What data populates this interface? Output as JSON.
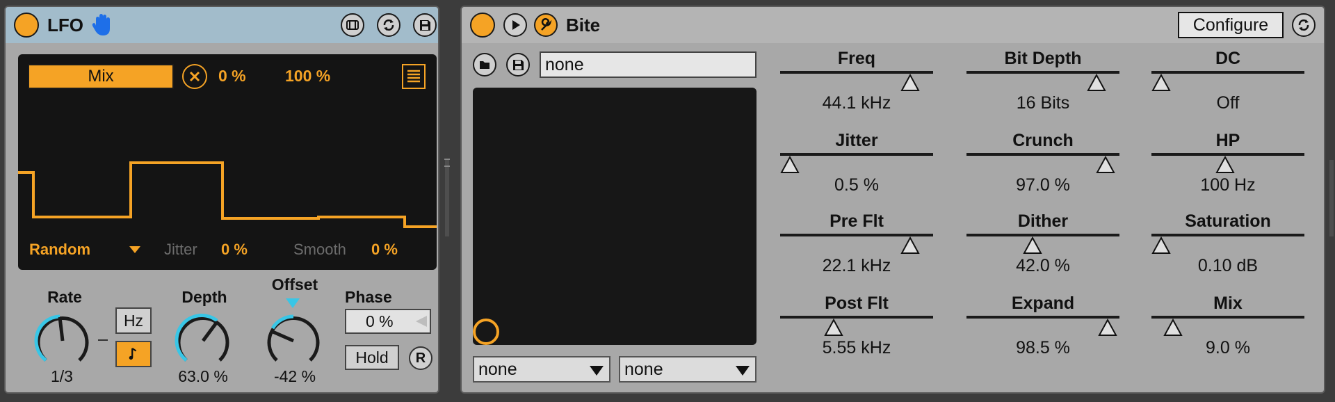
{
  "colors": {
    "accent": "#f5a325",
    "cyan": "#39c6e6",
    "display_bg": "#141414"
  },
  "lfo": {
    "title": "LFO",
    "header_icons": [
      "hand-icon",
      "map-icon",
      "hotswap-icon",
      "save-icon"
    ],
    "display": {
      "target_label": "Mix",
      "min_value": "0 %",
      "max_value": "100 %",
      "waveform_label": "Random",
      "jitter_label": "Jitter",
      "jitter_value": "0 %",
      "smooth_label": "Smooth",
      "smooth_value": "0 %"
    },
    "rate": {
      "label": "Rate",
      "value": "1/3",
      "hz_label": "Hz",
      "sync_icon": "note-icon"
    },
    "depth": {
      "label": "Depth",
      "value": "63.0 %"
    },
    "offset": {
      "label": "Offset",
      "value": "-42 %"
    },
    "phase": {
      "label": "Phase",
      "value": "0 %",
      "hold_label": "Hold",
      "retrigger_label": "R"
    }
  },
  "bite": {
    "title": "Bite",
    "configure_label": "Configure",
    "preset_name": "none",
    "dropdown_x": "none",
    "dropdown_y": "none",
    "params": [
      {
        "name": "Freq",
        "value": "44.1 kHz",
        "level": 0.9
      },
      {
        "name": "Bit Depth",
        "value": "16 Bits",
        "level": 0.9
      },
      {
        "name": "DC",
        "value": "Off",
        "level": 0.0
      },
      {
        "name": "Jitter",
        "value": "0.5 %",
        "level": 0.0
      },
      {
        "name": "Crunch",
        "value": "97.0 %",
        "level": 0.97
      },
      {
        "name": "HP",
        "value": "100 Hz",
        "level": 0.48
      },
      {
        "name": "Pre Flt",
        "value": "22.1 kHz",
        "level": 0.9
      },
      {
        "name": "Dither",
        "value": "42.0 %",
        "level": 0.42
      },
      {
        "name": "Saturation",
        "value": "0.10 dB",
        "level": 0.0
      },
      {
        "name": "Post Flt",
        "value": "5.55 kHz",
        "level": 0.33
      },
      {
        "name": "Expand",
        "value": "98.5 %",
        "level": 0.985
      },
      {
        "name": "Mix",
        "value": "9.0 %",
        "level": 0.09
      }
    ]
  }
}
